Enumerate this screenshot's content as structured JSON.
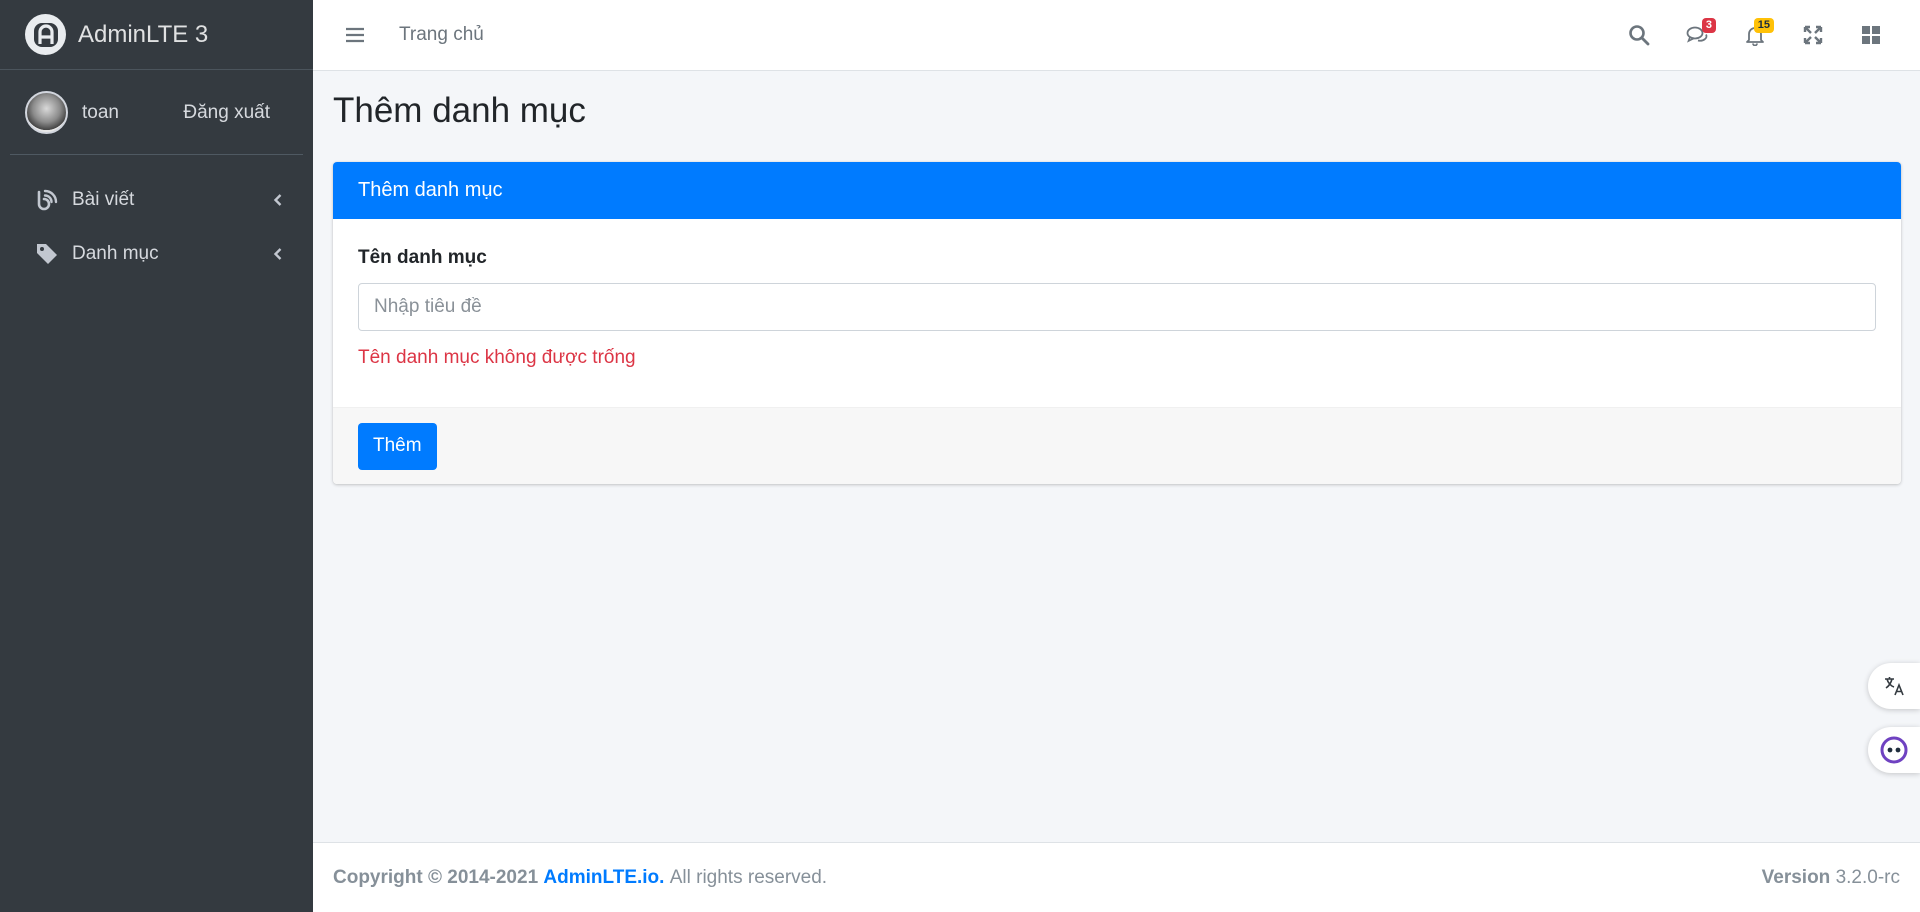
{
  "brand": {
    "name": "AdminLTE 3"
  },
  "user": {
    "name": "toan",
    "logout_label": "Đăng xuất"
  },
  "sidebar": {
    "items": [
      {
        "label": "Bài viết",
        "icon": "blog-icon"
      },
      {
        "label": "Danh mục",
        "icon": "tag-icon"
      }
    ]
  },
  "topbar": {
    "home_label": "Trang chủ",
    "messages_badge": "3",
    "notifications_badge": "15"
  },
  "page": {
    "title": "Thêm danh mục"
  },
  "form": {
    "header": "Thêm danh mục",
    "label": "Tên danh mục",
    "placeholder": "Nhập tiêu đề",
    "value": "",
    "error": "Tên danh mục không được trống",
    "submit_label": "Thêm"
  },
  "footer": {
    "copyright_prefix": "Copyright © 2014-2021",
    "link_text": "AdminLTE.io.",
    "rights": "All rights reserved.",
    "version_label": "Version",
    "version_value": "3.2.0-rc"
  },
  "colors": {
    "primary": "#007bff",
    "sidebar_bg": "#343a40",
    "danger": "#dc3545",
    "warning": "#ffc107"
  }
}
